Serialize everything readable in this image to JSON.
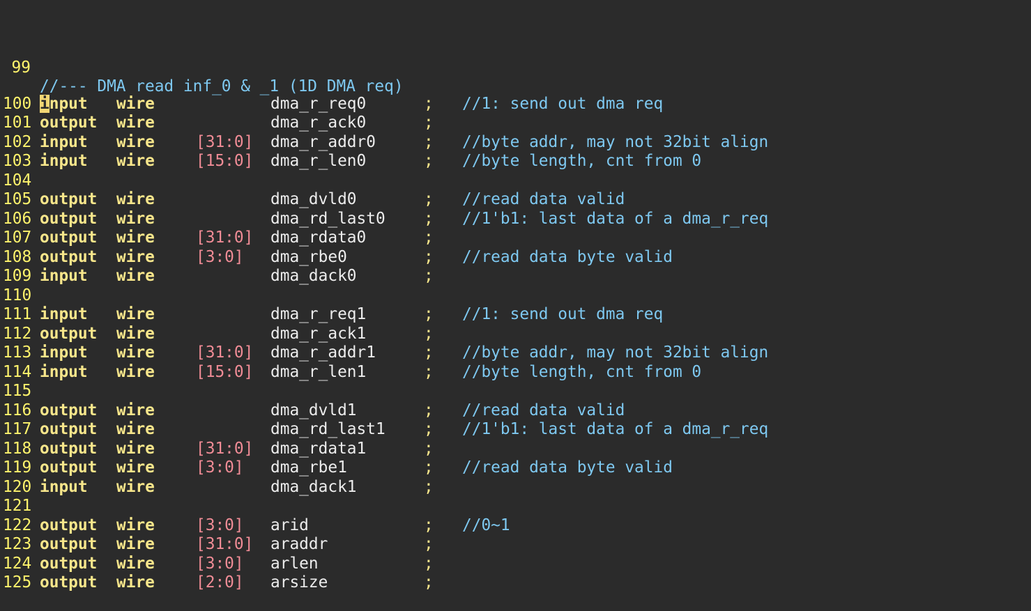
{
  "header": {
    "num": "99",
    "text": "//--- DMA read inf_0 & _1 (1D DMA req)"
  },
  "cursor": {
    "line": "100",
    "char": "i",
    "rest": "nput"
  },
  "lines": [
    {
      "num": "100",
      "dir": "input",
      "type": "wire",
      "range": "",
      "sig": "dma_r_req0",
      "semi": ";",
      "cmt": "//1: send out dma req"
    },
    {
      "num": "101",
      "dir": "output",
      "type": "wire",
      "range": "",
      "sig": "dma_r_ack0",
      "semi": ";",
      "cmt": ""
    },
    {
      "num": "102",
      "dir": "input",
      "type": "wire",
      "range": "[31:0]",
      "sig": "dma_r_addr0",
      "semi": ";",
      "cmt": "//byte addr, may not 32bit align"
    },
    {
      "num": "103",
      "dir": "input",
      "type": "wire",
      "range": "[15:0]",
      "sig": "dma_r_len0",
      "semi": ";",
      "cmt": "//byte length, cnt from 0"
    },
    {
      "num": "104",
      "dir": "",
      "type": "",
      "range": "",
      "sig": "",
      "semi": "",
      "cmt": ""
    },
    {
      "num": "105",
      "dir": "output",
      "type": "wire",
      "range": "",
      "sig": "dma_dvld0",
      "semi": ";",
      "cmt": "//read data valid"
    },
    {
      "num": "106",
      "dir": "output",
      "type": "wire",
      "range": "",
      "sig": "dma_rd_last0",
      "semi": ";",
      "cmt": "//1'b1: last data of a dma_r_req"
    },
    {
      "num": "107",
      "dir": "output",
      "type": "wire",
      "range": "[31:0]",
      "sig": "dma_rdata0",
      "semi": ";",
      "cmt": ""
    },
    {
      "num": "108",
      "dir": "output",
      "type": "wire",
      "range": "[3:0]",
      "sig": "dma_rbe0",
      "semi": ";",
      "cmt": "//read data byte valid"
    },
    {
      "num": "109",
      "dir": "input",
      "type": "wire",
      "range": "",
      "sig": "dma_dack0",
      "semi": ";",
      "cmt": ""
    },
    {
      "num": "110",
      "dir": "",
      "type": "",
      "range": "",
      "sig": "",
      "semi": "",
      "cmt": ""
    },
    {
      "num": "111",
      "dir": "input",
      "type": "wire",
      "range": "",
      "sig": "dma_r_req1",
      "semi": ";",
      "cmt": "//1: send out dma req"
    },
    {
      "num": "112",
      "dir": "output",
      "type": "wire",
      "range": "",
      "sig": "dma_r_ack1",
      "semi": ";",
      "cmt": ""
    },
    {
      "num": "113",
      "dir": "input",
      "type": "wire",
      "range": "[31:0]",
      "sig": "dma_r_addr1",
      "semi": ";",
      "cmt": "//byte addr, may not 32bit align"
    },
    {
      "num": "114",
      "dir": "input",
      "type": "wire",
      "range": "[15:0]",
      "sig": "dma_r_len1",
      "semi": ";",
      "cmt": "//byte length, cnt from 0"
    },
    {
      "num": "115",
      "dir": "",
      "type": "",
      "range": "",
      "sig": "",
      "semi": "",
      "cmt": ""
    },
    {
      "num": "116",
      "dir": "output",
      "type": "wire",
      "range": "",
      "sig": "dma_dvld1",
      "semi": ";",
      "cmt": "//read data valid"
    },
    {
      "num": "117",
      "dir": "output",
      "type": "wire",
      "range": "",
      "sig": "dma_rd_last1",
      "semi": ";",
      "cmt": "//1'b1: last data of a dma_r_req"
    },
    {
      "num": "118",
      "dir": "output",
      "type": "wire",
      "range": "[31:0]",
      "sig": "dma_rdata1",
      "semi": ";",
      "cmt": ""
    },
    {
      "num": "119",
      "dir": "output",
      "type": "wire",
      "range": "[3:0]",
      "sig": "dma_rbe1",
      "semi": ";",
      "cmt": "//read data byte valid"
    },
    {
      "num": "120",
      "dir": "input",
      "type": "wire",
      "range": "",
      "sig": "dma_dack1",
      "semi": ";",
      "cmt": ""
    },
    {
      "num": "121",
      "dir": "",
      "type": "",
      "range": "",
      "sig": "",
      "semi": "",
      "cmt": ""
    },
    {
      "num": "122",
      "dir": "output",
      "type": "wire",
      "range": "[3:0]",
      "sig": "arid",
      "semi": ";",
      "cmt": "//0~1"
    },
    {
      "num": "123",
      "dir": "output",
      "type": "wire",
      "range": "[31:0]",
      "sig": "araddr",
      "semi": ";",
      "cmt": ""
    },
    {
      "num": "124",
      "dir": "output",
      "type": "wire",
      "range": "[3:0]",
      "sig": "arlen",
      "semi": ";",
      "cmt": ""
    },
    {
      "num": "125",
      "dir": "output",
      "type": "wire",
      "range": "[2:0]",
      "sig": "arsize",
      "semi": ";",
      "cmt": ""
    }
  ]
}
